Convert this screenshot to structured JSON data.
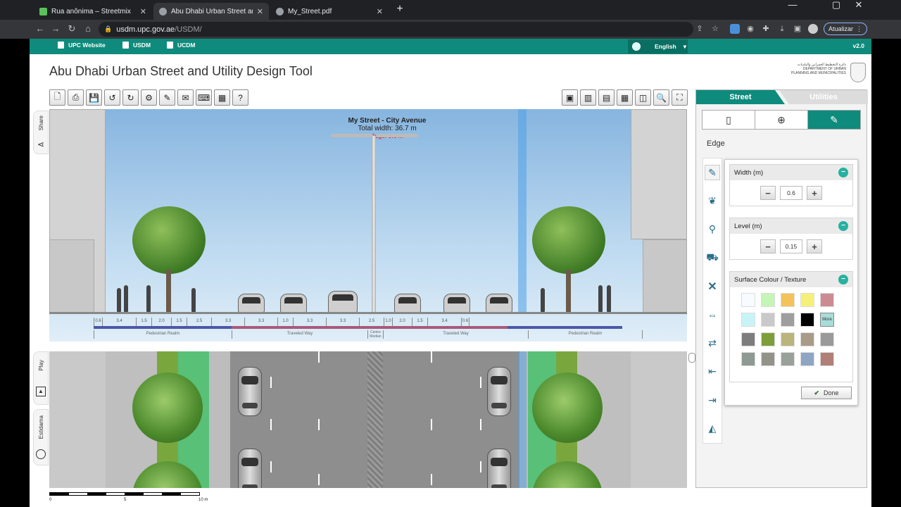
{
  "browser": {
    "tabs": [
      {
        "title": "Rua anônima – Streetmix",
        "favicon_color": "#5bc25b"
      },
      {
        "title": "Abu Dhabi Urban Street and Utili",
        "favicon_color": "#9aa0a6"
      },
      {
        "title": "My_Street.pdf",
        "favicon_color": "#9aa0a6"
      }
    ],
    "close_glyph": "✕",
    "new_tab_glyph": "+",
    "window_controls": {
      "minimize": "—",
      "maximize": "▢",
      "close": "✕"
    },
    "url_host": "usdm.upc.gov.ae",
    "url_path": "/USDM/",
    "update_button": "Atualizar"
  },
  "site_nav": {
    "links": [
      "UPC Website",
      "USDM",
      "UCDM"
    ],
    "language": "English",
    "version": "v2.0"
  },
  "app": {
    "title": "Abu Dhabi Urban Street and Utility Design Tool",
    "logo_text": "دائرة التخطيط العمراني والبلديات DEPARTMENT OF URBAN PLANNING AND MUNICIPALITIES"
  },
  "toolbar_left": [
    {
      "name": "new-file-icon",
      "glyph": "🗋"
    },
    {
      "name": "print-icon",
      "glyph": "⎙"
    },
    {
      "name": "save-icon",
      "glyph": "💾"
    },
    {
      "name": "undo-icon",
      "glyph": "↺"
    },
    {
      "name": "redo-icon",
      "glyph": "↻"
    },
    {
      "name": "settings-icon",
      "glyph": "⚙"
    },
    {
      "name": "edit-icon",
      "glyph": "✎"
    },
    {
      "name": "email-icon",
      "glyph": "✉"
    },
    {
      "name": "keyboard-icon",
      "glyph": "⌨"
    },
    {
      "name": "calendar-icon",
      "glyph": "▦"
    },
    {
      "name": "help-icon",
      "glyph": "?"
    }
  ],
  "toolbar_right": [
    {
      "name": "section-view-icon",
      "glyph": "▣"
    },
    {
      "name": "grid-view-icon",
      "glyph": "▥"
    },
    {
      "name": "dimension-view-icon",
      "glyph": "▤"
    },
    {
      "name": "plan-view-icon",
      "glyph": "▦"
    },
    {
      "name": "split-view-icon",
      "glyph": "◫"
    },
    {
      "name": "zoom-icon",
      "glyph": "🔍"
    },
    {
      "name": "fullscreen-icon",
      "glyph": "⛶"
    }
  ],
  "side_tabs": {
    "share": "Share",
    "play": "Play",
    "estidama": "Estidama"
  },
  "street": {
    "name": "My Street - City Avenue",
    "total_width": "Total width: 36.7 m",
    "edge": "Edge: 0.6 m"
  },
  "dimensions": [
    "0.6",
    "3.4",
    "1.5",
    "2.0",
    "1.5",
    "2.5",
    "3.3",
    "3.3",
    "1.0",
    "3.3",
    "3.3",
    "2.5",
    "1.0",
    "2.0",
    "1.5",
    "3.4",
    "0.6"
  ],
  "realms": [
    "Pedestrian Realm",
    "Traveled Way",
    "Centre Median",
    "Traveled Way",
    "Pedestrian Realm"
  ],
  "scale": {
    "labels": [
      "0",
      "5",
      "10 m"
    ]
  },
  "panel": {
    "tab_street": "Street",
    "tab_utilities": "Utilities",
    "category_icons": [
      "lamp-icon",
      "add-element-icon",
      "edit-element-icon"
    ],
    "element_label": "Edge",
    "side_icons": [
      "edge-edit-icon",
      "planting-icon",
      "pedestrian-icon",
      "transit-icon",
      "delete-icon",
      "move-icon",
      "swap-icon",
      "move-left-icon",
      "move-right-icon",
      "mirror-icon"
    ],
    "width": {
      "label": "Width (m)",
      "value": "0.6"
    },
    "level": {
      "label": "Level (m)",
      "value": "0.15"
    },
    "surface": {
      "label": "Surface Colour / Texture",
      "swatches": [
        "#f8fbff",
        "#c6f5b8",
        "#f4c25a",
        "#f6f07a",
        "#cc8a92",
        "#c8f4f8",
        "#c9c9c9",
        "#9e9e9e",
        "#000000",
        "#a8dcd8",
        "#7d7d7d",
        "#7d9e3a",
        "#bbb47d",
        "#a89b88",
        "#9a9a9a",
        "#8e9a94",
        "#93938a",
        "#9aa09a",
        "#8fa5c4",
        "#b07f78"
      ],
      "more_label": "More"
    },
    "done_label": "Done"
  }
}
